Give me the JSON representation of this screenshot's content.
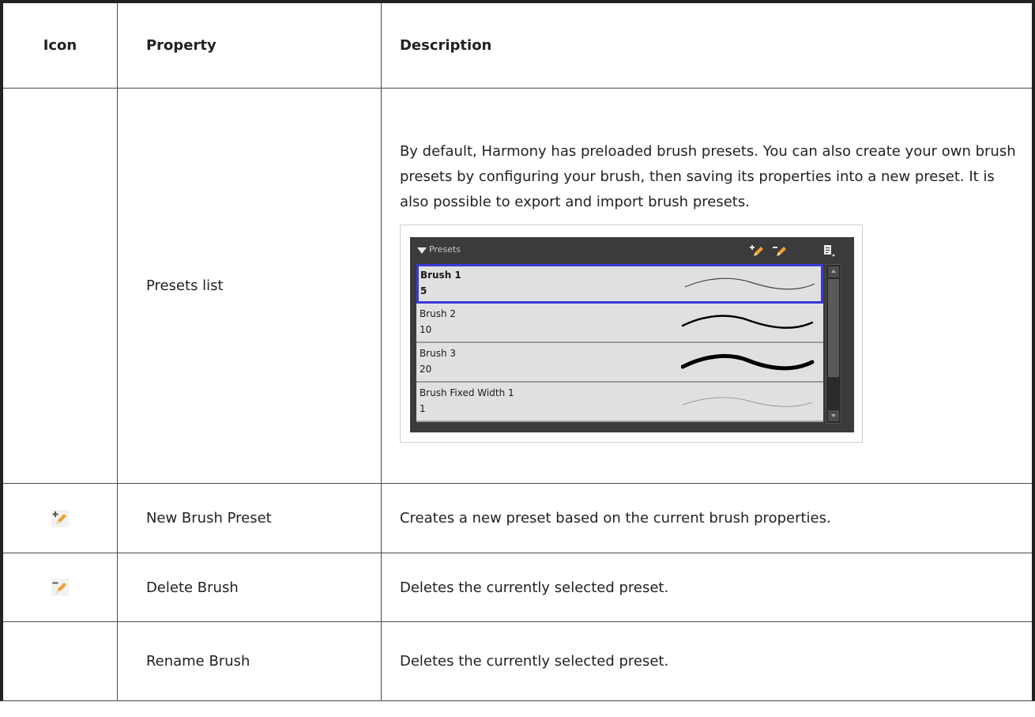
{
  "table": {
    "headers": {
      "icon": "Icon",
      "property": "Property",
      "description": "Description"
    },
    "rows": [
      {
        "icon": "",
        "property": "Presets list",
        "description": "By default, Harmony has preloaded brush presets. You can also create your own brush presets by configuring your brush, then saving its properties into a new preset. It is also possible to export and import brush presets."
      },
      {
        "icon": "new-brush-preset-icon",
        "property": "New Brush Preset",
        "description": "Creates a new preset based on the current brush properties."
      },
      {
        "icon": "delete-brush-icon",
        "property": "Delete Brush",
        "description": "Deletes the currently selected preset."
      },
      {
        "icon": "",
        "property": "Rename Brush",
        "description": "Deletes the currently selected preset."
      }
    ]
  },
  "presets_panel": {
    "title": "Presets",
    "items": [
      {
        "name": "Brush 1",
        "size": "5",
        "selected": true
      },
      {
        "name": "Brush 2",
        "size": "10",
        "selected": false
      },
      {
        "name": "Brush 3",
        "size": "20",
        "selected": false
      },
      {
        "name": "Brush Fixed Width 1",
        "size": "1",
        "selected": false
      }
    ],
    "icons": [
      "new-preset-icon",
      "delete-preset-icon",
      "panel-menu-icon"
    ]
  },
  "colors": {
    "panel_bg": "#3b3b3b",
    "item_bg": "#e0e0e0",
    "selected_border": "#3a3ad6",
    "pencil_orange": "#f0a030"
  }
}
